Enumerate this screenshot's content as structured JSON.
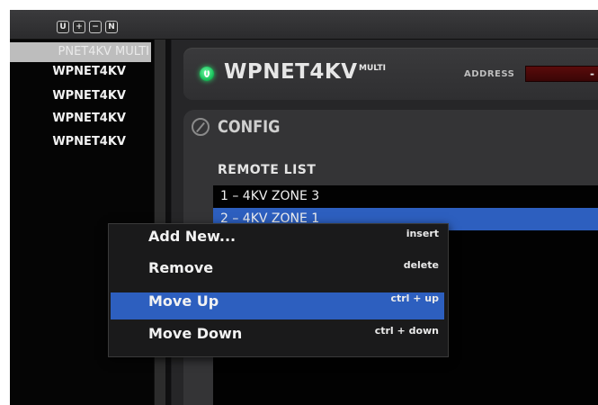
{
  "toolbar": {
    "buttons": [
      {
        "label": "U",
        "icon": "u-icon"
      },
      {
        "label": "+",
        "icon": "plus-icon"
      },
      {
        "label": "−",
        "icon": "minus-icon"
      },
      {
        "label": "N",
        "icon": "n-icon"
      }
    ]
  },
  "sidebar": {
    "selected_label": "PNET4KV MULTI",
    "items": [
      "WPNET4KV",
      "WPNET4KV",
      "WPNET4KV",
      "WPNET4KV"
    ]
  },
  "device": {
    "title": "WPNET4KV",
    "title_suffix": "MULTI",
    "address_label": "ADDRESS",
    "address_value": "-",
    "status_color": "#19c35c"
  },
  "config": {
    "title": "CONFIG",
    "remote_list_label": "REMOTE LIST",
    "remotes": [
      {
        "label": "1 – 4KV ZONE 3",
        "selected": false
      },
      {
        "label": "2 – 4KV ZONE 1",
        "selected": true
      }
    ]
  },
  "context_menu": {
    "items": [
      {
        "label": "Add New...",
        "shortcut": "insert",
        "highlighted": false
      },
      {
        "label": "Remove",
        "shortcut": "delete",
        "highlighted": false
      },
      {
        "label": "Move Up",
        "shortcut": "ctrl + up",
        "highlighted": true
      },
      {
        "label": "Move Down",
        "shortcut": "ctrl + down",
        "highlighted": false
      }
    ]
  },
  "colors": {
    "selection": "#2d5fbf",
    "background": "#1d1d1f",
    "address_box": "#4a0909"
  }
}
